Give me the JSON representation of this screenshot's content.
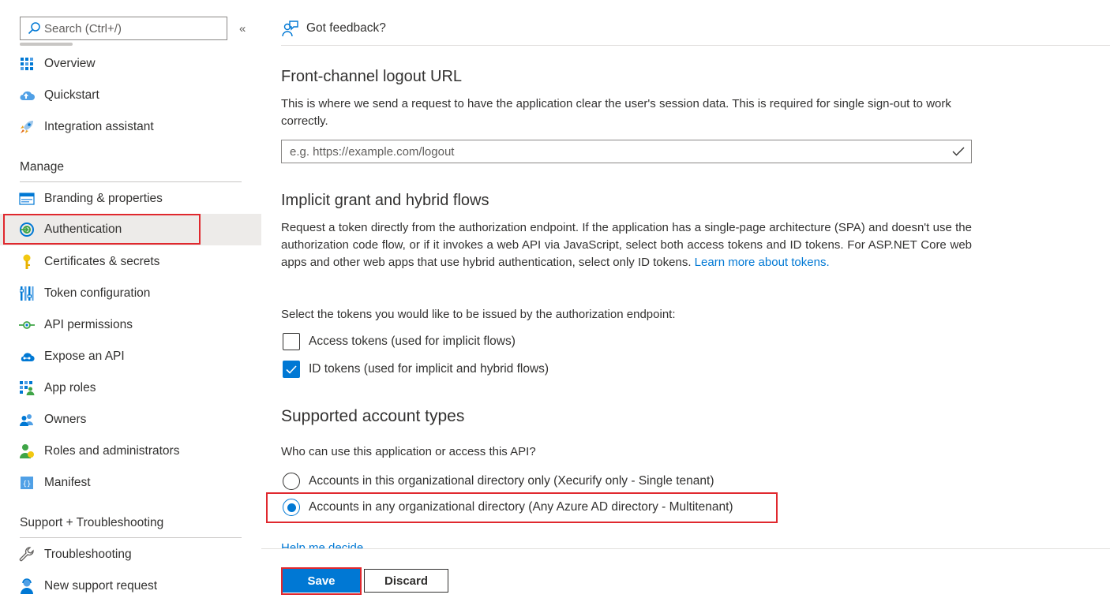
{
  "sidebar": {
    "search_placeholder": "Search (Ctrl+/)",
    "collapse_glyph": "«",
    "top_items": [
      {
        "label": "Overview",
        "icon": "overview-grid-icon"
      },
      {
        "label": "Quickstart",
        "icon": "quickstart-cloud-icon"
      },
      {
        "label": "Integration assistant",
        "icon": "rocket-icon"
      }
    ],
    "manage_header": "Manage",
    "manage_items": [
      {
        "label": "Branding & properties",
        "icon": "branding-icon"
      },
      {
        "label": "Authentication",
        "icon": "authentication-icon",
        "selected": true
      },
      {
        "label": "Certificates & secrets",
        "icon": "key-icon"
      },
      {
        "label": "Token configuration",
        "icon": "token-bars-icon"
      },
      {
        "label": "API permissions",
        "icon": "api-permissions-icon"
      },
      {
        "label": "Expose an API",
        "icon": "expose-api-cloud-icon"
      },
      {
        "label": "App roles",
        "icon": "app-roles-icon"
      },
      {
        "label": "Owners",
        "icon": "owners-icon"
      },
      {
        "label": "Roles and administrators",
        "icon": "roles-admin-icon"
      },
      {
        "label": "Manifest",
        "icon": "manifest-icon"
      }
    ],
    "support_header": "Support + Troubleshooting",
    "support_items": [
      {
        "label": "Troubleshooting",
        "icon": "wrench-icon"
      },
      {
        "label": "New support request",
        "icon": "support-person-icon"
      }
    ]
  },
  "main": {
    "feedback_label": "Got feedback?",
    "logout": {
      "title": "Front-channel logout URL",
      "description": "This is where we send a request to have the application clear the user's session data. This is required for single sign-out to work correctly.",
      "input_placeholder": "e.g. https://example.com/logout",
      "input_value": ""
    },
    "implicit": {
      "title": "Implicit grant and hybrid flows",
      "description": "Request a token directly from the authorization endpoint. If the application has a single-page architecture (SPA) and doesn't use the authorization code flow, or if it invokes a web API via JavaScript, select both access tokens and ID tokens. For ASP.NET Core web apps and other web apps that use hybrid authentication, select only ID tokens.",
      "learn_more": "Learn more about tokens.",
      "select_prompt": "Select the tokens you would like to be issued by the authorization endpoint:",
      "options": [
        {
          "label": "Access tokens (used for implicit flows)",
          "checked": false
        },
        {
          "label": "ID tokens (used for implicit and hybrid flows)",
          "checked": true
        }
      ]
    },
    "account_types": {
      "title": "Supported account types",
      "question": "Who can use this application or access this API?",
      "options": [
        {
          "label": "Accounts in this organizational directory only (Xecurify only - Single tenant)",
          "selected": false
        },
        {
          "label": "Accounts in any organizational directory (Any Azure AD directory - Multitenant)",
          "selected": true
        }
      ],
      "help_link": "Help me decide..."
    },
    "footer": {
      "save_label": "Save",
      "discard_label": "Discard"
    }
  },
  "colors": {
    "accent": "#0078d4",
    "highlight_border": "#e0282e",
    "selected_bg": "#edebe9",
    "text": "#323130"
  }
}
